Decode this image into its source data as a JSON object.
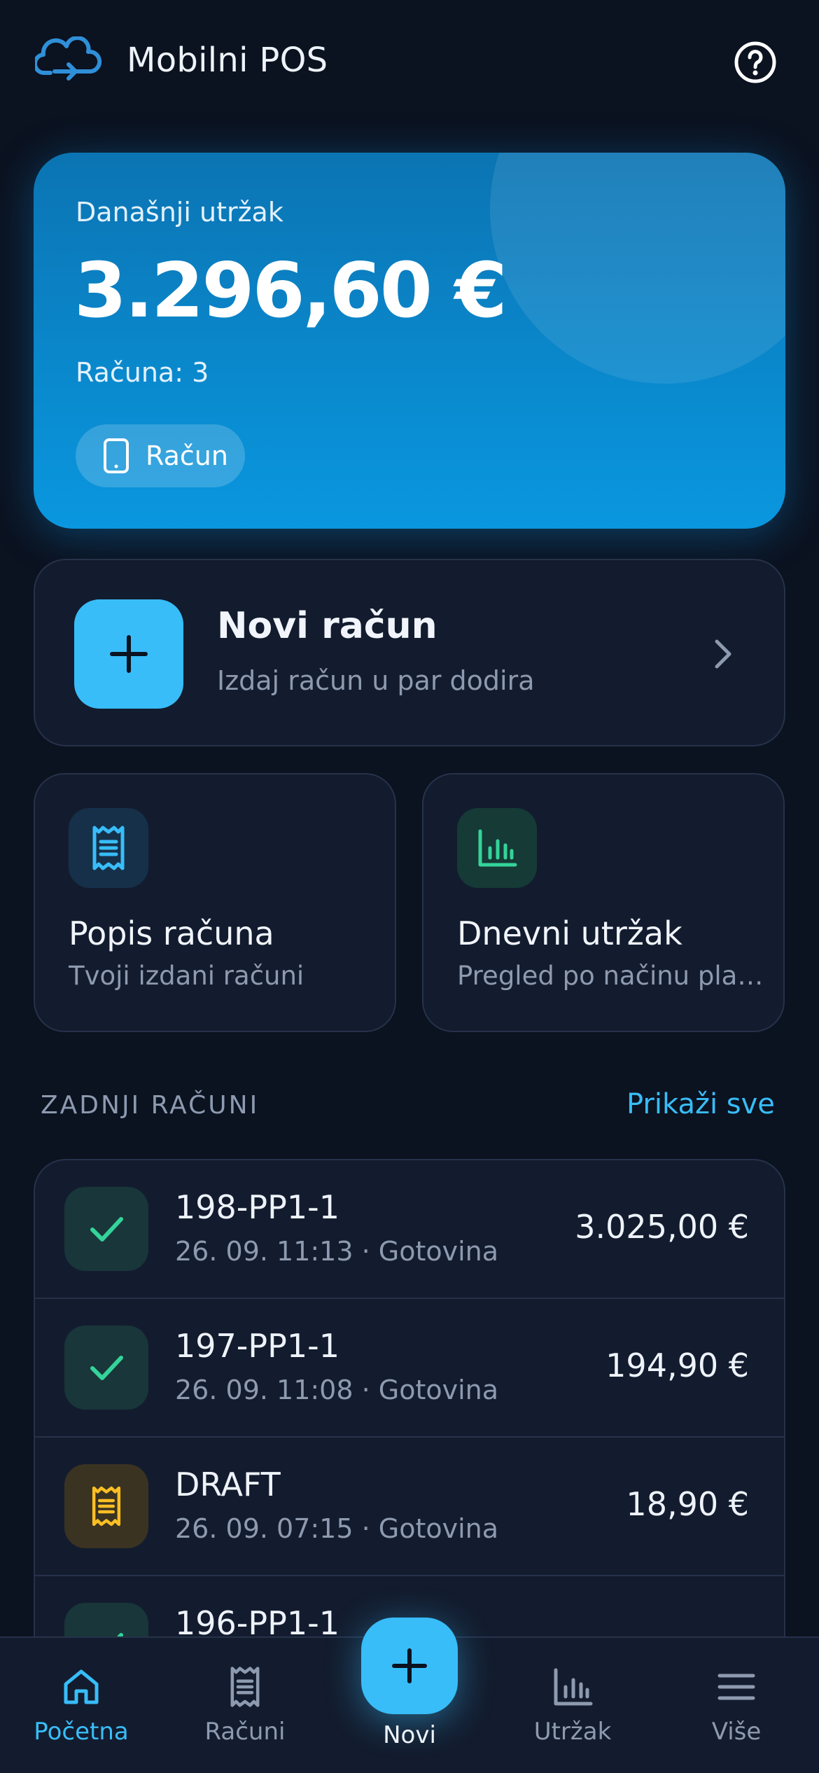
{
  "header": {
    "title": "Mobilni POS",
    "logo_icon": "cloud-sync-icon",
    "help_icon": "help-circle-icon"
  },
  "revenue": {
    "label": "Današnji utržak",
    "amount": "3.296,60 €",
    "count_text": "Računa: 3",
    "button_label": "Račun",
    "button_icon": "phone-icon"
  },
  "new_receipt": {
    "title": "Novi račun",
    "subtitle": "Izdaj račun u par dodira"
  },
  "tiles": [
    {
      "title": "Popis računa",
      "subtitle": "Tvoji izdani računi",
      "icon": "receipt-icon",
      "icon_color": "#38bdf8"
    },
    {
      "title": "Dnevni utržak",
      "subtitle": "Pregled po načinu plaćanja",
      "icon": "bar-chart-icon",
      "icon_color": "#34d399"
    }
  ],
  "recent": {
    "title": "ZADNJI RAČUNI",
    "show_all": "Prikaži sve",
    "items": [
      {
        "number": "198-PP1-1",
        "meta": "26. 09. 11:13 · Gotovina",
        "amount": "3.025,00 €",
        "status": "done"
      },
      {
        "number": "197-PP1-1",
        "meta": "26. 09. 11:08 · Gotovina",
        "amount": "194,90 €",
        "status": "done"
      },
      {
        "number": "DRAFT",
        "meta": "26. 09. 07:15 · Gotovina",
        "amount": "18,90 €",
        "status": "draft"
      },
      {
        "number": "196-PP1-1",
        "meta": "",
        "amount": "",
        "status": "done"
      }
    ]
  },
  "nav": {
    "home": "Početna",
    "receipts": "Računi",
    "new": "Novi",
    "revenue": "Utržak",
    "more": "Više"
  },
  "colors": {
    "accent": "#38bdf8",
    "success": "#34d399",
    "warning": "#fbbf24",
    "background": "#0b1220"
  }
}
